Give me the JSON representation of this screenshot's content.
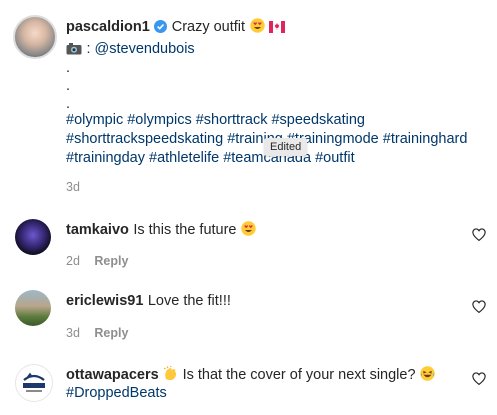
{
  "post": {
    "username": "pascaldion1",
    "caption": "Crazy outfit",
    "credit": ": @stevendubois",
    "dots": [
      ".",
      ".",
      "."
    ],
    "hashtag_lines": [
      "#olympic #olympics #shorttrack #speedskating",
      "#shorttrackspeedskating #training #trainingmode #traininghard",
      "#trainingday #athletelife #teamcanada #outfit"
    ],
    "time": "3d",
    "tooltip": "Edited"
  },
  "comments": [
    {
      "username": "tamkaivo",
      "text": "Is this the future",
      "time": "2d",
      "reply": "Reply"
    },
    {
      "username": "ericlewis91",
      "text": "Love the fit!!!",
      "time": "3d",
      "reply": "Reply"
    },
    {
      "username": "ottawapacers",
      "text": "Is that the cover of your next single?",
      "tag": "#DroppedBeats"
    }
  ],
  "colors": {
    "hashtag": "#00376b",
    "verified": "#3897f0",
    "muted": "#8e8e8e"
  },
  "icons": [
    "verified-badge-icon",
    "heart-eyes-emoji",
    "canada-flag-emoji",
    "camera-emoji",
    "clapping-hands-emoji",
    "laughing-emoji",
    "heart-icon"
  ]
}
